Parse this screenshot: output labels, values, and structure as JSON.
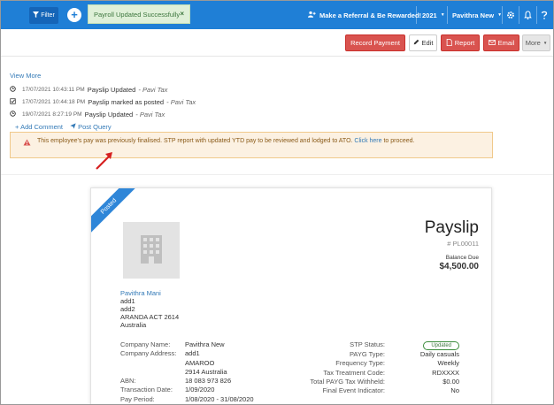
{
  "topbar": {
    "filter_label": "Filter",
    "toast_message": "Payroll Updated Successfully",
    "toast_close": "×",
    "referral_label": "Make a Referral & Be Rewarded!",
    "year_label": "2021",
    "user_label": "Pavithra New",
    "accent": "#1f7fd6"
  },
  "actions": {
    "record_payment": "Record Payment",
    "edit": "Edit",
    "report": "Report",
    "email": "Email",
    "more": "More"
  },
  "activity": {
    "view_more": "View More",
    "items": [
      {
        "timestamp": "17/07/2021 10:43:11 PM",
        "text": "Payslip Updated",
        "by": "Pavi Tax",
        "icon": "clock-icon"
      },
      {
        "timestamp": "17/07/2021 10:44:18 PM",
        "text": "Payslip marked as posted",
        "by": "Pavi Tax",
        "icon": "checkbox-icon"
      },
      {
        "timestamp": "19/07/2021 8:27:19 PM",
        "text": "Payslip Updated",
        "by": "Pavi Tax",
        "icon": "clock-icon"
      }
    ],
    "dash": "-",
    "add_comment": "Add Comment",
    "post_query": "Post Query"
  },
  "alert": {
    "text_before": "This employee's pay was previously finalised. STP report with updated YTD pay to be reviewed and lodged to ATO. ",
    "link": "Click here",
    "text_after": " to proceed."
  },
  "payslip": {
    "ribbon": "Posted",
    "title": "Payslip",
    "number": "# PL00011",
    "balance_label": "Balance Due",
    "balance_value": "$4,500.00",
    "employee": {
      "name": "Pavithra Mani",
      "lines": [
        "add1",
        "add2",
        "ARANDA ACT 2614",
        "Australia"
      ]
    },
    "left_labels": [
      "Company Name:",
      "Company Address:",
      "",
      "",
      "ABN:",
      "Transaction Date:",
      "Pay Period:"
    ],
    "left_values": [
      "Pavithra New",
      "add1",
      "AMAROO",
      "2914 Australia",
      "18 083 973 826",
      "1/09/2020",
      "1/08/2020 - 31/08/2020"
    ],
    "right_labels": [
      "STP Status:",
      "PAYG Type:",
      "Frequency Type:",
      "Tax Treatment Code:",
      "Total PAYG Tax Withheld:",
      "Final Event Indicator:"
    ],
    "right_values": [
      "Updated",
      "Daily casuals",
      "Weekly",
      "RDXXXX",
      "$0.00",
      "No"
    ]
  }
}
